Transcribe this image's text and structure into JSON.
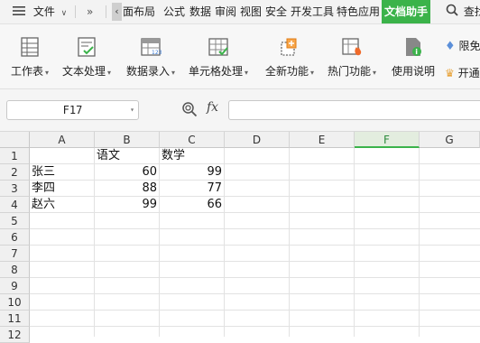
{
  "menubar": {
    "file_label": "文件",
    "tabs": [
      "页面布局",
      "公式",
      "数据",
      "审阅",
      "视图",
      "安全",
      "开发工具",
      "特色应用",
      "文档助手"
    ],
    "active_tab": "文档助手",
    "search_label": "查找"
  },
  "ribbon": {
    "buttons": [
      {
        "label": "工作表",
        "icon": "worksheet-icon"
      },
      {
        "label": "文本处理",
        "icon": "text-process-icon"
      },
      {
        "label": "数据录入",
        "icon": "data-entry-icon"
      },
      {
        "label": "单元格处理",
        "icon": "cell-process-icon"
      },
      {
        "label": "全新功能",
        "icon": "new-features-icon"
      },
      {
        "label": "热门功能",
        "icon": "hot-features-icon"
      },
      {
        "label": "使用说明",
        "icon": "instructions-icon"
      }
    ],
    "right_items": [
      "限免",
      "开通"
    ]
  },
  "formula_bar": {
    "name_box": "F17",
    "fx": "fx",
    "formula": ""
  },
  "sheet": {
    "columns": [
      "A",
      "B",
      "C",
      "D",
      "E",
      "F",
      "G"
    ],
    "selected_column": "F",
    "rows": [
      "1",
      "2",
      "3",
      "4",
      "5",
      "6",
      "7",
      "8",
      "9",
      "10",
      "11",
      "12"
    ],
    "cells": {
      "B1": "语文",
      "C1": "数学",
      "A2": "张三",
      "B2": "60",
      "C2": "99",
      "A3": "李四",
      "B3": "88",
      "C3": "77",
      "A4": "赵六",
      "B4": "99",
      "C4": "66"
    }
  },
  "colors": {
    "accent": "#3bb34a",
    "header_bg": "#f0f0f0"
  }
}
